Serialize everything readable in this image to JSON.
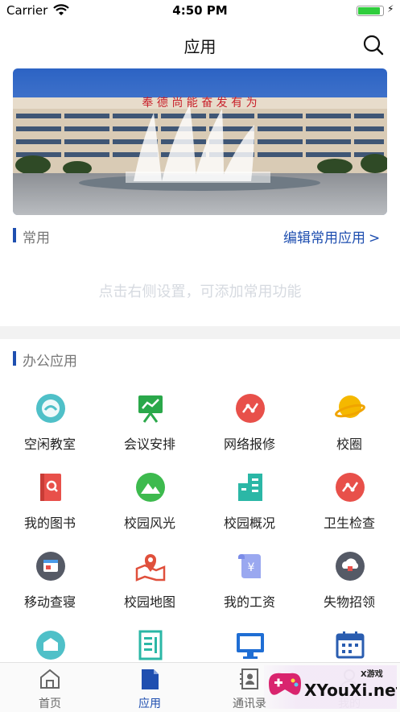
{
  "status_bar": {
    "carrier": "Carrier",
    "time": "4:50 PM"
  },
  "nav": {
    "title": "应用"
  },
  "banner": {
    "building_sign": "奉 德 尚 能   奋 发 有 为"
  },
  "common": {
    "label": "常用",
    "edit_link": "编辑常用应用",
    "hint": "点击右侧设置，可添加常用功能"
  },
  "office": {
    "label": "办公应用",
    "apps": [
      {
        "label": "空闲教室",
        "icon": "classroom-icon",
        "color": "#4fc0c8"
      },
      {
        "label": "会议安排",
        "icon": "meeting-icon",
        "color": "#2aa84a"
      },
      {
        "label": "网络报修",
        "icon": "network-repair-icon",
        "color": "#e8504a"
      },
      {
        "label": "校圈",
        "icon": "planet-icon",
        "color": "#f5b800"
      },
      {
        "label": "我的图书",
        "icon": "book-icon",
        "color": "#e8504a"
      },
      {
        "label": "校园风光",
        "icon": "scenery-icon",
        "color": "#3dba4e"
      },
      {
        "label": "校园概况",
        "icon": "buildings-icon",
        "color": "#2bb7a6"
      },
      {
        "label": "卫生检查",
        "icon": "health-check-icon",
        "color": "#e8504a"
      },
      {
        "label": "移动查寝",
        "icon": "dorm-check-icon",
        "color": "#555a66"
      },
      {
        "label": "校园地图",
        "icon": "map-icon",
        "color": "#e0503c"
      },
      {
        "label": "我的工资",
        "icon": "salary-icon",
        "color": "#7b8ce8"
      },
      {
        "label": "失物招领",
        "icon": "lost-found-icon",
        "color": "#555a66"
      },
      {
        "label": "",
        "icon": "inbox-icon",
        "color": "#4fc0c8"
      },
      {
        "label": "",
        "icon": "document-icon",
        "color": "#2bb7a6"
      },
      {
        "label": "",
        "icon": "monitor-icon",
        "color": "#1f6ed4"
      },
      {
        "label": "",
        "icon": "calendar-icon",
        "color": "#2a5db0"
      }
    ]
  },
  "tabbar": {
    "tabs": [
      {
        "label": "首页",
        "icon": "home-icon",
        "active": false
      },
      {
        "label": "应用",
        "icon": "apps-icon",
        "active": true
      },
      {
        "label": "通讯录",
        "icon": "contacts-icon",
        "active": false
      },
      {
        "label": "我的",
        "icon": "profile-icon",
        "active": false
      }
    ]
  },
  "watermark": {
    "text": "XYouXi.net",
    "tag": "X游戏"
  },
  "colors": {
    "accent": "#1f4fb0",
    "hint": "#d6dae0",
    "divider": "#f2f2f2"
  }
}
